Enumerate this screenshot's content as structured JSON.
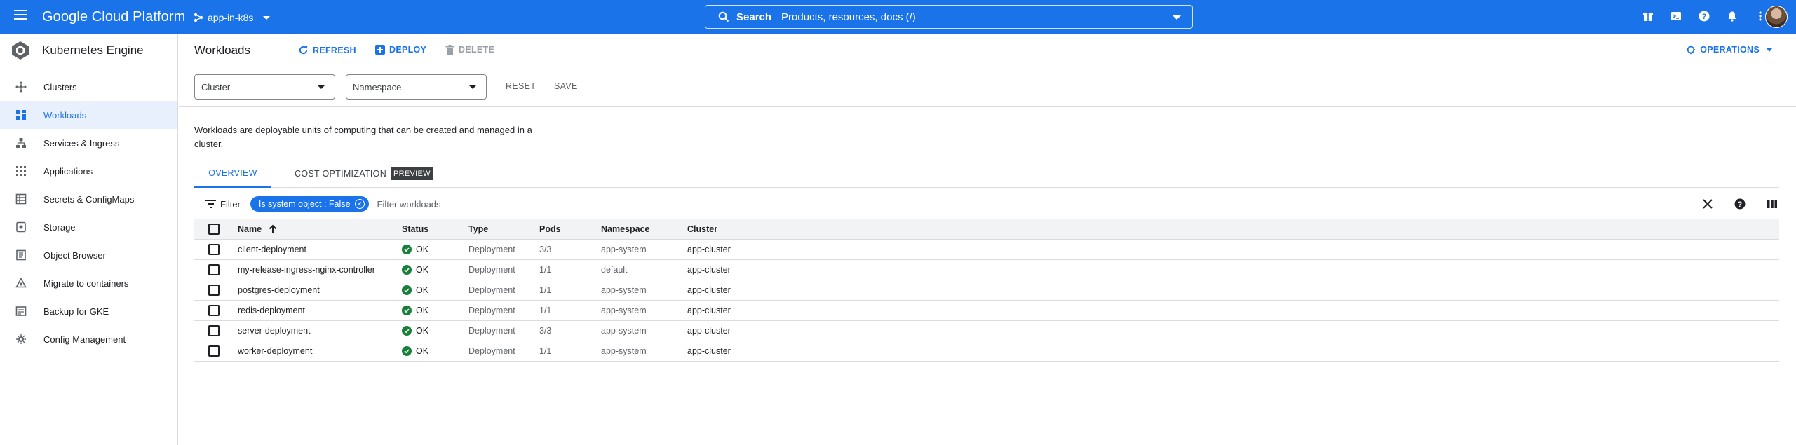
{
  "topbar": {
    "brand": "Google Cloud Platform",
    "project": "app-in-k8s",
    "search_label": "Search",
    "search_placeholder": "Products, resources, docs (/)",
    "color": "#1a73e8"
  },
  "sidebar": {
    "title": "Kubernetes Engine",
    "items": [
      {
        "label": "Clusters",
        "icon": "clusters-icon"
      },
      {
        "label": "Workloads",
        "icon": "workloads-icon",
        "active": true
      },
      {
        "label": "Services & Ingress",
        "icon": "services-icon"
      },
      {
        "label": "Applications",
        "icon": "applications-icon"
      },
      {
        "label": "Secrets & ConfigMaps",
        "icon": "secrets-icon"
      },
      {
        "label": "Storage",
        "icon": "storage-icon"
      },
      {
        "label": "Object Browser",
        "icon": "object-browser-icon"
      },
      {
        "label": "Migrate to containers",
        "icon": "migrate-icon"
      },
      {
        "label": "Backup for GKE",
        "icon": "backup-icon"
      },
      {
        "label": "Config Management",
        "icon": "config-management-icon"
      }
    ]
  },
  "toolbar": {
    "title": "Workloads",
    "refresh": "REFRESH",
    "deploy": "DEPLOY",
    "delete": "DELETE",
    "operations": "OPERATIONS"
  },
  "filters": {
    "cluster_placeholder": "Cluster",
    "namespace_placeholder": "Namespace",
    "reset": "RESET",
    "save": "SAVE"
  },
  "description": "Workloads are deployable units of computing that can be created and managed in a cluster.",
  "tabs": {
    "overview": "OVERVIEW",
    "cost": "COST OPTIMIZATION",
    "preview_badge": "PREVIEW"
  },
  "filterbar": {
    "label": "Filter",
    "chip": "Is system object : False",
    "placeholder": "Filter workloads"
  },
  "table": {
    "headers": {
      "name": "Name",
      "status": "Status",
      "type": "Type",
      "pods": "Pods",
      "namespace": "Namespace",
      "cluster": "Cluster"
    },
    "rows": [
      {
        "name": "client-deployment",
        "status": "OK",
        "type": "Deployment",
        "pods": "3/3",
        "namespace": "app-system",
        "cluster": "app-cluster"
      },
      {
        "name": "my-release-ingress-nginx-controller",
        "status": "OK",
        "type": "Deployment",
        "pods": "1/1",
        "namespace": "default",
        "cluster": "app-cluster"
      },
      {
        "name": "postgres-deployment",
        "status": "OK",
        "type": "Deployment",
        "pods": "1/1",
        "namespace": "app-system",
        "cluster": "app-cluster"
      },
      {
        "name": "redis-deployment",
        "status": "OK",
        "type": "Deployment",
        "pods": "1/1",
        "namespace": "app-system",
        "cluster": "app-cluster"
      },
      {
        "name": "server-deployment",
        "status": "OK",
        "type": "Deployment",
        "pods": "3/3",
        "namespace": "app-system",
        "cluster": "app-cluster"
      },
      {
        "name": "worker-deployment",
        "status": "OK",
        "type": "Deployment",
        "pods": "1/1",
        "namespace": "app-system",
        "cluster": "app-cluster"
      }
    ]
  }
}
